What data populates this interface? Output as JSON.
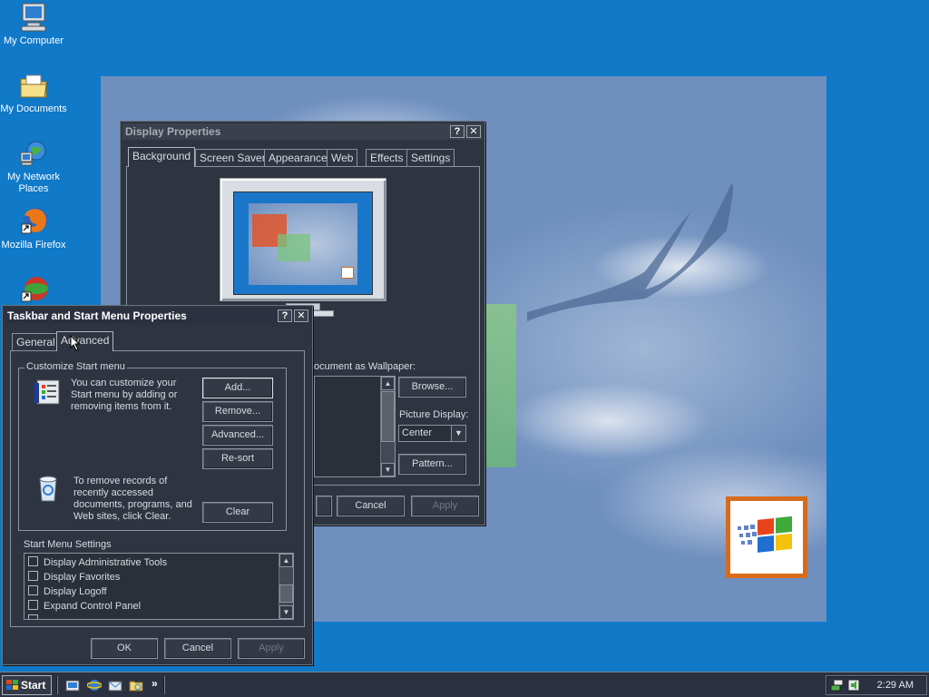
{
  "desktop": {
    "icons": [
      {
        "label": "My Computer",
        "icon": "computer-icon"
      },
      {
        "label": "My Documents",
        "icon": "folder-icon"
      },
      {
        "label": "My Network",
        "label2": "Places",
        "icon": "network-icon"
      },
      {
        "label": "Mozilla Firefox",
        "icon": "firefox-icon"
      },
      {
        "label": "",
        "icon": "app-icon"
      }
    ]
  },
  "display_properties": {
    "title": "Display Properties",
    "tabs": [
      "Background",
      "Screen Saver",
      "Appearance",
      "Web",
      "Effects",
      "Settings"
    ],
    "selected_tab": "Background",
    "wallpaper_label": "ocument as Wallpaper:",
    "browse": "Browse...",
    "picture_display_label": "Picture Display:",
    "picture_display_value": "Center",
    "pattern": "Pattern...",
    "cancel": "Cancel",
    "apply": "Apply"
  },
  "taskbar_props": {
    "title": "Taskbar and Start Menu Properties",
    "tabs": [
      "General",
      "Advanced"
    ],
    "selected_tab": "Advanced",
    "customize_group": "Customize Start menu",
    "customize_text_1": "You can customize your",
    "customize_text_2": "Start menu by adding or",
    "customize_text_3": "removing items from it.",
    "buttons": {
      "add": "Add...",
      "remove": "Remove...",
      "advanced": "Advanced...",
      "resort": "Re-sort",
      "clear": "Clear"
    },
    "records_text_1": "To remove records of",
    "records_text_2": "recently accessed",
    "records_text_3": "documents, programs, and",
    "records_text_4": "Web sites,  click Clear.",
    "settings_label": "Start Menu Settings",
    "settings": [
      "Display Administrative Tools",
      "Display Favorites",
      "Display Logoff",
      "Expand Control Panel"
    ],
    "ok": "OK",
    "cancel": "Cancel",
    "apply": "Apply"
  },
  "taskbar": {
    "start": "Start",
    "chevron": "»",
    "clock": "2:29 AM"
  }
}
